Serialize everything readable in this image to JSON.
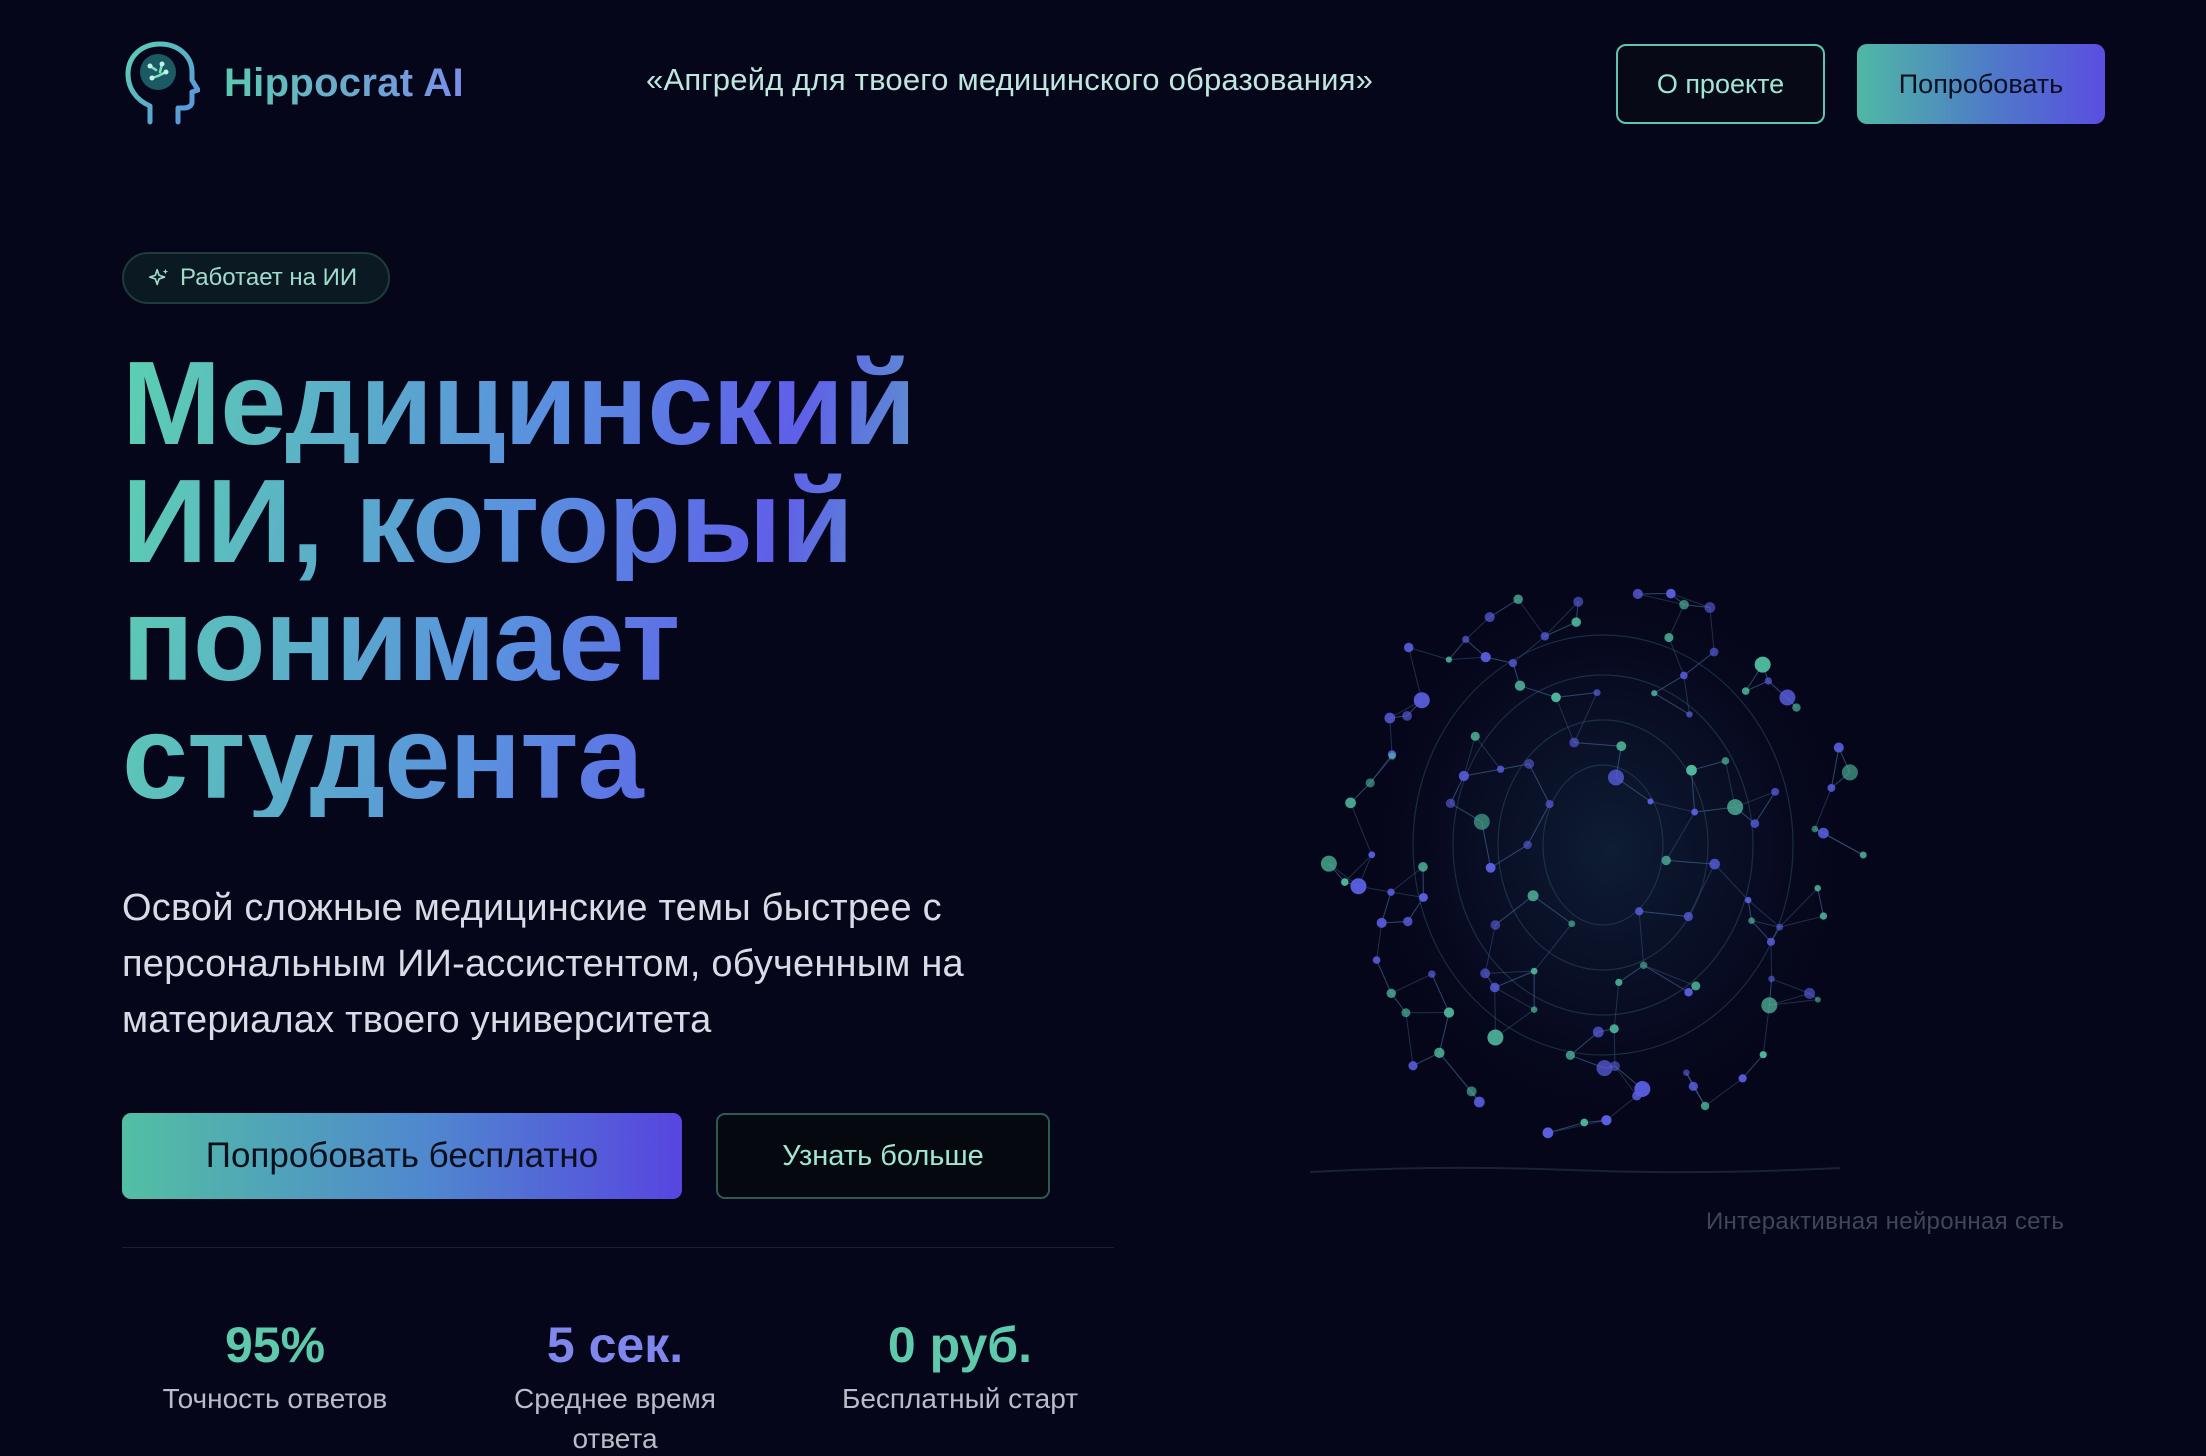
{
  "header": {
    "brand": "Hippocrat AI",
    "tagline": "«Апгрейд для твоего медицинского образования»",
    "about_label": "О проекте",
    "try_label": "Попробовать"
  },
  "hero": {
    "badge": "Работает на ИИ",
    "title_lines": [
      "Медицинский",
      "ИИ, который",
      "понимает",
      "студента"
    ],
    "subtitle_lines": [
      "Освой сложные медицинские темы быстрее с",
      "персональным ИИ-ассистентом, обученным на",
      "материалах твоего университета"
    ],
    "primary_cta": "Попробовать бесплатно",
    "secondary_cta": "Узнать больше"
  },
  "stats": [
    {
      "value": "95%",
      "label": "Точность ответов"
    },
    {
      "value": "5 сек.",
      "label": "Среднее время ответа"
    },
    {
      "value": "0 руб.",
      "label": "Бесплатный старт"
    }
  ],
  "network": {
    "caption": "Интерактивная нейронная сеть"
  },
  "colors": {
    "background": "#05061a",
    "accent_teal": "#5cc9b0",
    "accent_indigo": "#5a4ee0"
  },
  "icons": {
    "logo": "brain-head-icon",
    "badge": "sparkle-icon"
  }
}
